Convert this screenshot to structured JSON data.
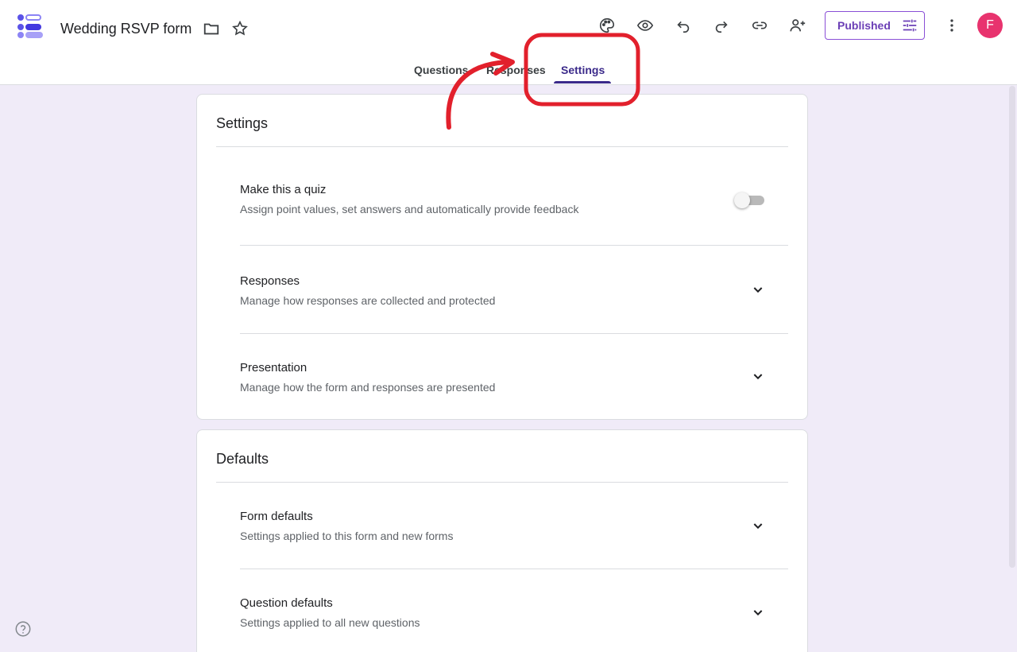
{
  "header": {
    "title": "Wedding RSVP form",
    "publish_label": "Published",
    "avatar_initial": "F",
    "icons": [
      "folder-icon",
      "star-icon",
      "palette-icon",
      "eye-icon",
      "undo-icon",
      "redo-icon",
      "link-icon",
      "add-person-icon",
      "tune-icon",
      "more-vert-icon"
    ]
  },
  "tabs": [
    {
      "label": "Questions"
    },
    {
      "label": "Responses"
    },
    {
      "label": "Settings",
      "active": true
    }
  ],
  "settings_card": {
    "title": "Settings",
    "quiz": {
      "title": "Make this a quiz",
      "subtitle": "Assign point values, set answers and automatically provide feedback",
      "enabled": false
    },
    "responses": {
      "title": "Responses",
      "subtitle": "Manage how responses are collected and protected"
    },
    "presentation": {
      "title": "Presentation",
      "subtitle": "Manage how the form and responses are presented"
    }
  },
  "defaults_card": {
    "title": "Defaults",
    "form_defaults": {
      "title": "Form defaults",
      "subtitle": "Settings applied to this form and new forms"
    },
    "question_defaults": {
      "title": "Question defaults",
      "subtitle": "Settings applied to all new questions"
    }
  },
  "colors": {
    "background": "#f0ebf8",
    "accent": "#3b2a8a",
    "publish": "#6b3fb6",
    "avatar": "#e8336e",
    "annotation": "#e2202c"
  }
}
